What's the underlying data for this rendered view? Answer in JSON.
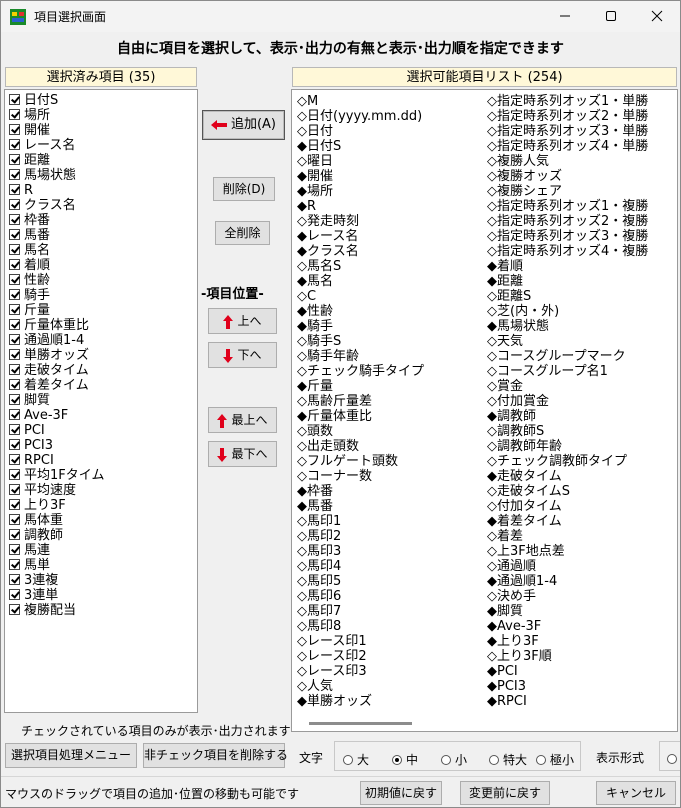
{
  "window": {
    "title": "項目選択画面"
  },
  "heading": "自由に項目を選択して、表示･出力の有無と表示･出力順を指定できます",
  "selected_panel": {
    "header": "選択済み項目 (35)",
    "items": [
      "日付S",
      "場所",
      "開催",
      "レース名",
      "距離",
      "馬場状態",
      "R",
      "クラス名",
      "枠番",
      "馬番",
      "馬名",
      "着順",
      "性齢",
      "騎手",
      "斤量",
      "斤量体重比",
      "通過順1-4",
      "単勝オッズ",
      "走破タイム",
      "着差タイム",
      "脚質",
      "Ave-3F",
      "PCI",
      "PCI3",
      "RPCI",
      "平均1Fタイム",
      "平均速度",
      "上り3F",
      "馬体重",
      "調教師",
      "馬連",
      "馬単",
      "3連複",
      "3連単",
      "複勝配当"
    ],
    "note": "チェックされている項目のみが表示･出力されます"
  },
  "available_panel": {
    "header": "選択可能項目リスト (254)",
    "col1": [
      {
        "label": "M",
        "on": false
      },
      {
        "label": "日付(yyyy.mm.dd)",
        "on": false
      },
      {
        "label": "日付",
        "on": false
      },
      {
        "label": "日付S",
        "on": true
      },
      {
        "label": "曜日",
        "on": false
      },
      {
        "label": "開催",
        "on": true
      },
      {
        "label": "場所",
        "on": true
      },
      {
        "label": "R",
        "on": true
      },
      {
        "label": "発走時刻",
        "on": false
      },
      {
        "label": "レース名",
        "on": true
      },
      {
        "label": "クラス名",
        "on": true
      },
      {
        "label": "馬名S",
        "on": false
      },
      {
        "label": "馬名",
        "on": true
      },
      {
        "label": "C",
        "on": false
      },
      {
        "label": "性齢",
        "on": true
      },
      {
        "label": "騎手",
        "on": true
      },
      {
        "label": "騎手S",
        "on": false
      },
      {
        "label": "騎手年齢",
        "on": false
      },
      {
        "label": "チェック騎手タイプ",
        "on": false
      },
      {
        "label": "斤量",
        "on": true
      },
      {
        "label": "馬齢斤量差",
        "on": false
      },
      {
        "label": "斤量体重比",
        "on": true
      },
      {
        "label": "頭数",
        "on": false
      },
      {
        "label": "出走頭数",
        "on": false
      },
      {
        "label": "フルゲート頭数",
        "on": false
      },
      {
        "label": "コーナー数",
        "on": false
      },
      {
        "label": "枠番",
        "on": true
      },
      {
        "label": "馬番",
        "on": true
      },
      {
        "label": "馬印1",
        "on": false
      },
      {
        "label": "馬印2",
        "on": false
      },
      {
        "label": "馬印3",
        "on": false
      },
      {
        "label": "馬印4",
        "on": false
      },
      {
        "label": "馬印5",
        "on": false
      },
      {
        "label": "馬印6",
        "on": false
      },
      {
        "label": "馬印7",
        "on": false
      },
      {
        "label": "馬印8",
        "on": false
      },
      {
        "label": "レース印1",
        "on": false
      },
      {
        "label": "レース印2",
        "on": false
      },
      {
        "label": "レース印3",
        "on": false
      },
      {
        "label": "人気",
        "on": false
      },
      {
        "label": "単勝オッズ",
        "on": true
      }
    ],
    "col2": [
      {
        "label": "指定時系列オッズ1・単勝",
        "on": false
      },
      {
        "label": "指定時系列オッズ2・単勝",
        "on": false
      },
      {
        "label": "指定時系列オッズ3・単勝",
        "on": false
      },
      {
        "label": "指定時系列オッズ4・単勝",
        "on": false
      },
      {
        "label": "複勝人気",
        "on": false
      },
      {
        "label": "複勝オッズ",
        "on": false
      },
      {
        "label": "複勝シェア",
        "on": false
      },
      {
        "label": "指定時系列オッズ1・複勝",
        "on": false
      },
      {
        "label": "指定時系列オッズ2・複勝",
        "on": false
      },
      {
        "label": "指定時系列オッズ3・複勝",
        "on": false
      },
      {
        "label": "指定時系列オッズ4・複勝",
        "on": false
      },
      {
        "label": "着順",
        "on": true
      },
      {
        "label": "距離",
        "on": true
      },
      {
        "label": "距離S",
        "on": false
      },
      {
        "label": "芝(内・外)",
        "on": false
      },
      {
        "label": "馬場状態",
        "on": true
      },
      {
        "label": "天気",
        "on": false
      },
      {
        "label": "コースグループマーク",
        "on": false
      },
      {
        "label": "コースグループ名1",
        "on": false
      },
      {
        "label": "賞金",
        "on": false
      },
      {
        "label": "付加賞金",
        "on": false
      },
      {
        "label": "調教師",
        "on": true
      },
      {
        "label": "調教師S",
        "on": false
      },
      {
        "label": "調教師年齢",
        "on": false
      },
      {
        "label": "チェック調教師タイプ",
        "on": false
      },
      {
        "label": "走破タイム",
        "on": true
      },
      {
        "label": "走破タイムS",
        "on": false
      },
      {
        "label": "付加タイム",
        "on": false
      },
      {
        "label": "着差タイム",
        "on": true
      },
      {
        "label": "着差",
        "on": false
      },
      {
        "label": "上3F地点差",
        "on": false
      },
      {
        "label": "通過順",
        "on": false
      },
      {
        "label": "通過順1-4",
        "on": true
      },
      {
        "label": "決め手",
        "on": false
      },
      {
        "label": "脚質",
        "on": true
      },
      {
        "label": "Ave-3F",
        "on": true
      },
      {
        "label": "上り3F",
        "on": true
      },
      {
        "label": "上り3F順",
        "on": false
      },
      {
        "label": "PCI",
        "on": true
      },
      {
        "label": "PCI3",
        "on": true
      },
      {
        "label": "RPCI",
        "on": true
      }
    ]
  },
  "buttons": {
    "add": "追加(A)",
    "delete": "削除(D)",
    "delete_all": "全削除",
    "position_label": "-項目位置-",
    "up": "上へ",
    "down": "下へ",
    "top": "最上へ",
    "bottom": "最下へ",
    "menu": "選択項目処理メニュー",
    "remove_unchecked": "非チェック項目を削除する",
    "reset_default": "初期値に戻す",
    "revert": "変更前に戻す",
    "cancel": "キャンセル"
  },
  "font_size": {
    "label": "文字",
    "options": [
      "大",
      "中",
      "小",
      "特大",
      "極小"
    ],
    "selected": "中"
  },
  "display_format_label": "表示形式",
  "status_hint": "マウスのドラッグで項目の追加･位置の移動も可能です",
  "colors": {
    "accent_red": "#e0001b",
    "header_bg": "#fff8d8"
  }
}
